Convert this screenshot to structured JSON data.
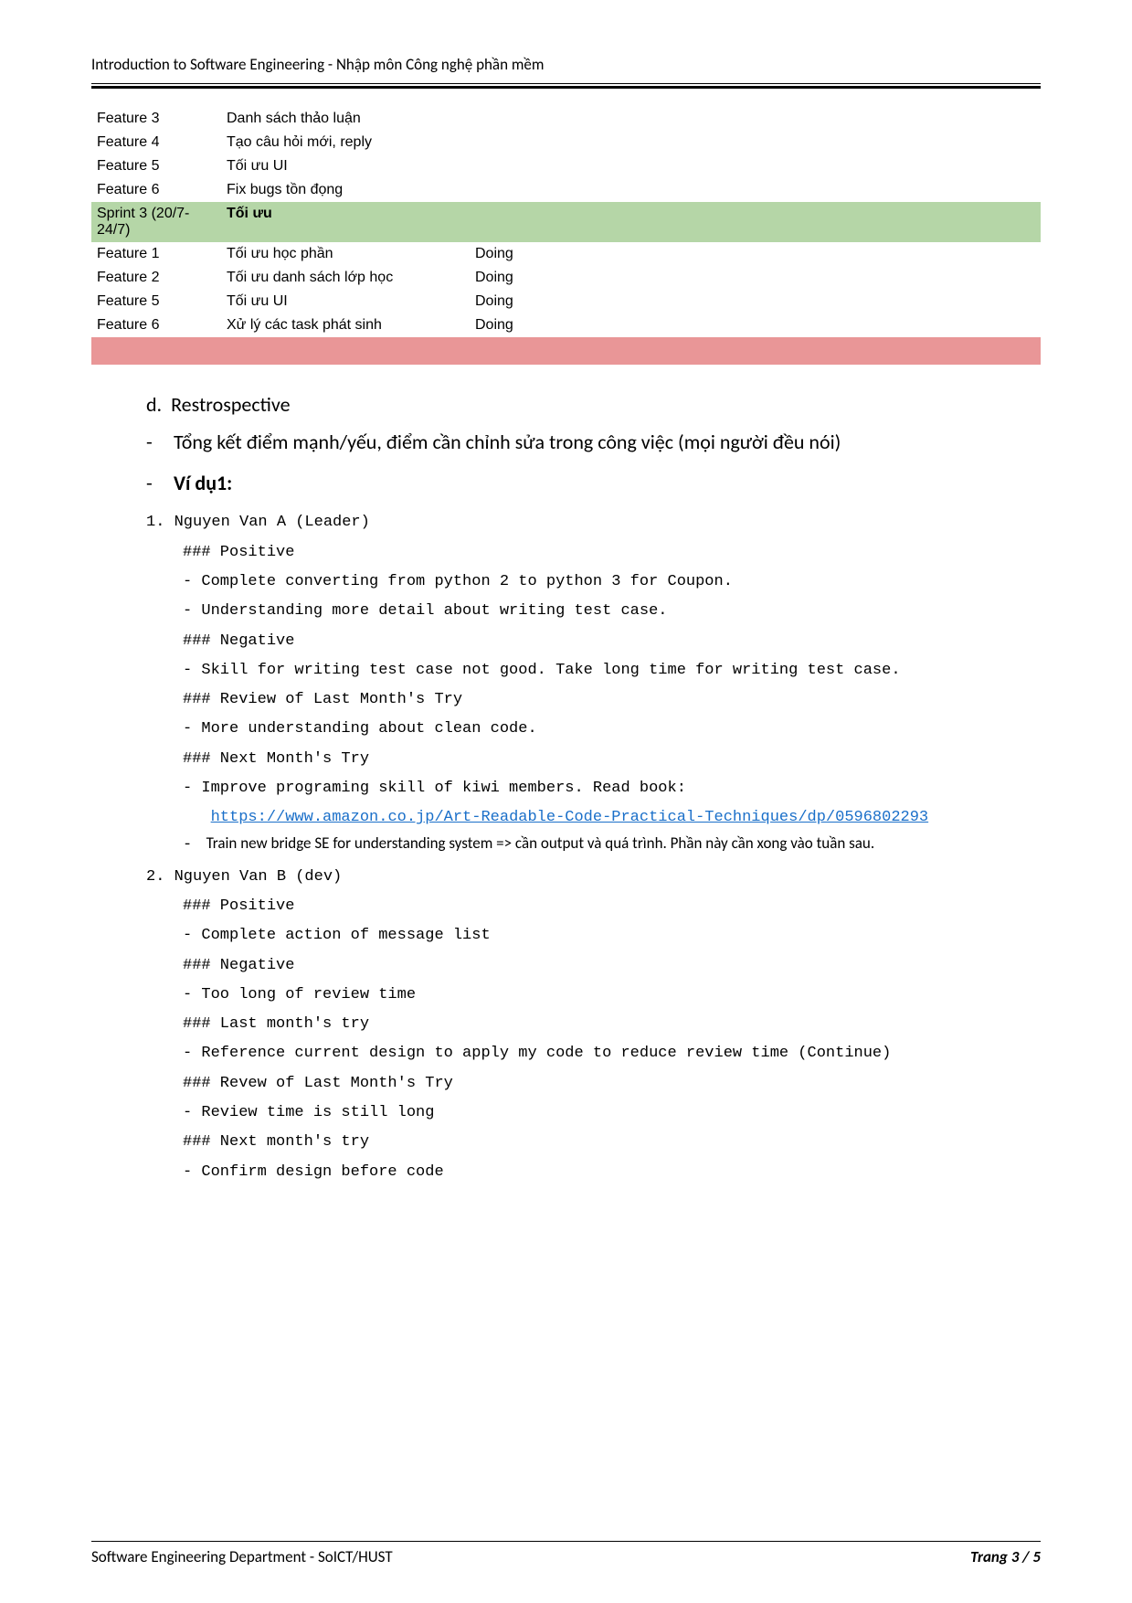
{
  "header": {
    "title": "Introduction to Software Engineering - Nhập môn Công nghệ phần mềm"
  },
  "table": {
    "rows": [
      {
        "type": "plain",
        "feat": "Feature 3",
        "desc": "Danh sách thảo luận",
        "status": ""
      },
      {
        "type": "plain",
        "feat": "Feature 4",
        "desc": "Tạo câu hỏi mới, reply",
        "status": ""
      },
      {
        "type": "plain",
        "feat": "Feature 5",
        "desc": "Tối ưu UI",
        "status": ""
      },
      {
        "type": "plain",
        "feat": "Feature 6",
        "desc": "Fix bugs tồn đọng",
        "status": ""
      },
      {
        "type": "green",
        "feat": "Sprint 3  (20/7-24/7)",
        "desc": "Tối ưu",
        "status": ""
      },
      {
        "type": "plain",
        "feat": "Feature 1",
        "desc": "Tối ưu học phần",
        "status": "Doing"
      },
      {
        "type": "plain",
        "feat": "Feature 2",
        "desc": "Tối ưu danh sách lớp học",
        "status": "Doing"
      },
      {
        "type": "plain",
        "feat": "Feature 5",
        "desc": "Tối ưu UI",
        "status": "Doing"
      },
      {
        "type": "plain",
        "feat": "Feature 6",
        "desc": "Xử lý các task phát sinh",
        "status": "Doing"
      },
      {
        "type": "red",
        "feat": "",
        "desc": "",
        "status": ""
      }
    ]
  },
  "sectionD": {
    "letter": "d.",
    "title": "Restrospective",
    "dash1": "Tổng kết điểm mạnh/yếu, điểm cần chỉnh sửa trong công việc (mọi người đều nói)",
    "dash2": "Ví dụ1:"
  },
  "person1": {
    "title": "1. Nguyen Van A (Leader)",
    "positive_h": "### Positive",
    "pos1": "-  Complete converting from python 2 to python 3 for Coupon.",
    "pos2": "-  Understanding more detail about writing test case.",
    "negative_h": "### Negative",
    "neg1": "- Skill for writing test case not good. Take long time for writing test case.",
    "review_h": "### Review of Last Month's Try",
    "rev1": "-  More understanding about clean code.",
    "next_h": "### Next Month's Try",
    "next1": "-  Improve programing skill of kiwi members. Read book:",
    "link": "https://www.amazon.co.jp/Art-Readable-Code-Practical-Techniques/dp/0596802293",
    "note_dash": "-",
    "note_text": "Train new bridge SE for understanding system => cần output và quá trình. Phần này cần xong vào tuần sau."
  },
  "person2": {
    "title": "2. Nguyen Van B (dev)",
    "positive_h": "### Positive",
    "pos1": "-  Complete action of message list",
    "negative_h": "### Negative",
    "neg1": "-  Too long of review time",
    "last_h": "### Last month's try",
    "last1": "-   Reference current design to apply my code to reduce review time (Continue)",
    "review_h": "### Revew of Last Month's Try",
    "rev1": "-  Review time is still long",
    "next_h": "### Next month's try",
    "next1": "-  Confirm design before code"
  },
  "footer": {
    "left": "Software Engineering Department - SoICT/HUST",
    "right": "Trang 3 / 5"
  }
}
